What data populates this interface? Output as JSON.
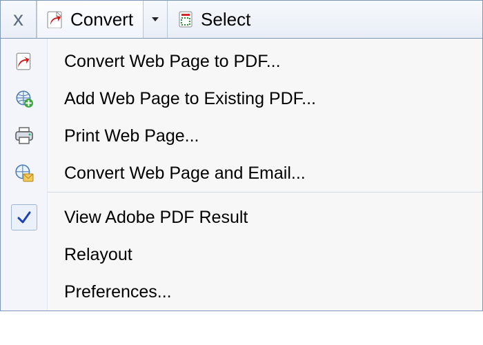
{
  "toolbar": {
    "close_label": "x",
    "convert_label": "Convert",
    "select_label": "Select"
  },
  "menu": {
    "items": [
      {
        "label": "Convert Web Page to PDF..."
      },
      {
        "label": "Add Web Page to Existing PDF..."
      },
      {
        "label": "Print Web Page..."
      },
      {
        "label": "Convert Web Page and Email..."
      }
    ],
    "items2": [
      {
        "label": "View Adobe PDF Result",
        "checked": true
      },
      {
        "label": "Relayout"
      },
      {
        "label": "Preferences..."
      }
    ]
  }
}
